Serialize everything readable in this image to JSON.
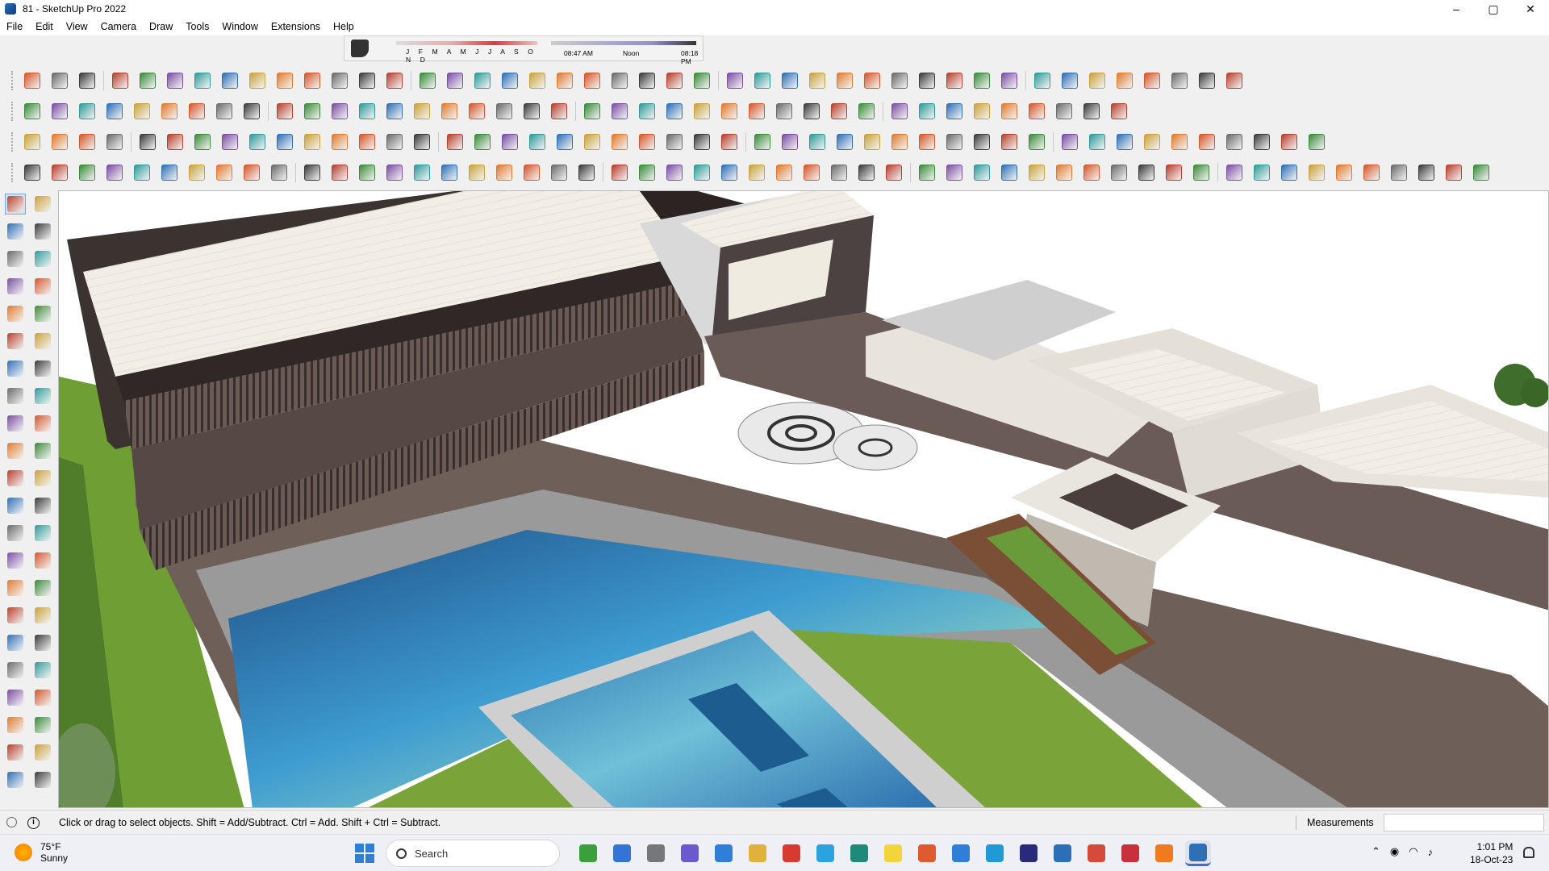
{
  "window": {
    "title": "81 - SketchUp Pro 2022",
    "controls": [
      "minimize",
      "maximize",
      "close"
    ]
  },
  "menu": [
    "File",
    "Edit",
    "View",
    "Camera",
    "Draw",
    "Tools",
    "Window",
    "Extensions",
    "Help"
  ],
  "shadow_settings": {
    "months_label": "J F M A M J J A S O N D",
    "time_start": "08:47 AM",
    "time_mid": "Noon",
    "time_end": "08:18 PM"
  },
  "status_bar": {
    "hint": "Click or drag to select objects. Shift = Add/Subtract. Ctrl = Add. Shift + Ctrl = Subtract.",
    "measurements_label": "Measurements",
    "measurements_value": ""
  },
  "taskbar": {
    "weather_temp": "75°F",
    "weather_cond": "Sunny",
    "search_placeholder": "Search",
    "time": "1:01 PM",
    "date": "18-Oct-23"
  },
  "colors": {
    "accent_blue": "#2f7ed8",
    "lawn_green": "#7aa33a",
    "water_blue": "#3e8fc8",
    "roof_white": "#f2efe8",
    "deck_brown": "#7b6a63"
  }
}
